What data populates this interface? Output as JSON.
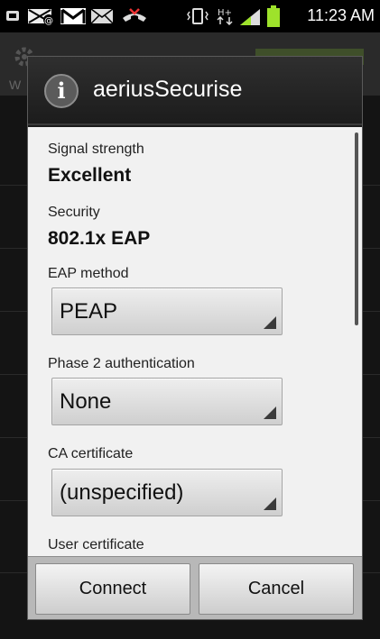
{
  "status_bar": {
    "time": "11:23 AM",
    "network_type": "H+",
    "icons": [
      "notification-icon",
      "missed-call-icon",
      "gmail-icon",
      "email-icon",
      "phone-end-icon",
      "vibrate-icon",
      "network-activity-icon",
      "signal-icon",
      "battery-icon"
    ]
  },
  "dialog": {
    "title": "aeriusSecurise",
    "title_icon": "info-icon",
    "fields": {
      "signal_strength_label": "Signal strength",
      "signal_strength_value": "Excellent",
      "security_label": "Security",
      "security_value": "802.1x EAP",
      "eap_method_label": "EAP method",
      "eap_method_value": "PEAP",
      "phase2_label": "Phase 2 authentication",
      "phase2_value": "None",
      "ca_cert_label": "CA certificate",
      "ca_cert_value": "(unspecified)",
      "user_cert_label": "User certificate"
    },
    "buttons": {
      "connect": "Connect",
      "cancel": "Cancel"
    }
  },
  "colors": {
    "dialog_body": "#f1f1f1",
    "dialog_header": "#262626",
    "battery": "#9ee22b"
  }
}
